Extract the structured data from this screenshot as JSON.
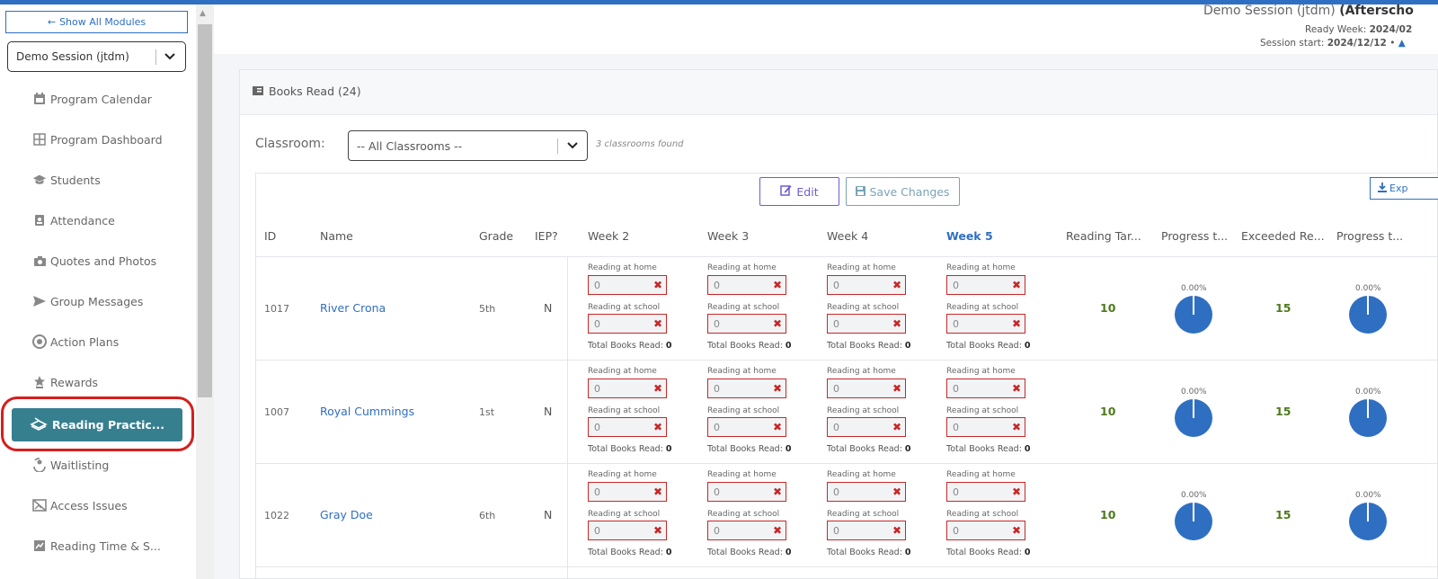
{
  "sidebar": {
    "show_all": "Show All Modules",
    "session": "Demo Session (jtdm)",
    "items": [
      {
        "label": "Program Calendar",
        "icon": "calendar-icon"
      },
      {
        "label": "Program Dashboard",
        "icon": "grid-icon"
      },
      {
        "label": "Students",
        "icon": "graduation-cap-icon"
      },
      {
        "label": "Attendance",
        "icon": "id-badge-icon"
      },
      {
        "label": "Quotes and Photos",
        "icon": "camera-icon"
      },
      {
        "label": "Group Messages",
        "icon": "send-icon"
      },
      {
        "label": "Action Plans",
        "icon": "target-icon"
      },
      {
        "label": "Rewards",
        "icon": "award-icon"
      },
      {
        "label": "Reading Practic...",
        "icon": "book-icon",
        "active": true
      },
      {
        "label": "Waitlisting",
        "icon": "user-refresh-icon"
      },
      {
        "label": "Access Issues",
        "icon": "no-image-icon"
      },
      {
        "label": "Reading Time & S...",
        "icon": "chart-icon"
      }
    ]
  },
  "header": {
    "session_name": "Demo Session (jtdm)",
    "session_type": "(Afterscho",
    "ready_week_label": "Ready Week:",
    "ready_week_value": "2024/02",
    "session_start_label": "Session start:",
    "session_start_value": "2024/12/12",
    "session_start_sep": "•"
  },
  "card": {
    "title": "Books Read (24)",
    "classroom_label": "Classroom:",
    "classroom_value": "-- All Classrooms --",
    "classrooms_found": "3 classrooms found",
    "edit_label": "Edit",
    "save_label": "Save Changes",
    "export_label": "Exp"
  },
  "table": {
    "columns": [
      "ID",
      "Name",
      "Grade",
      "IEP?",
      "Week 2",
      "Week 3",
      "Week 4",
      "Week 5",
      "Reading Tar...",
      "Progress t...",
      "Exceeded Re...",
      "Progress t..."
    ],
    "home_label": "Reading at home",
    "school_label": "Reading at school",
    "total_label": "Total Books Read:",
    "rows": [
      {
        "id": "1017",
        "name": "River Crona",
        "grade": "5th",
        "iep": "N",
        "home": "0",
        "school": "0",
        "total": "0",
        "target": "10",
        "progress1": "0.00%",
        "exceeded": "15",
        "progress2": "0.00%"
      },
      {
        "id": "1007",
        "name": "Royal Cummings",
        "grade": "1st",
        "iep": "N",
        "home": "0",
        "school": "0",
        "total": "0",
        "target": "10",
        "progress1": "0.00%",
        "exceeded": "15",
        "progress2": "0.00%"
      },
      {
        "id": "1022",
        "name": "Gray Doe",
        "grade": "6th",
        "iep": "N",
        "home": "0",
        "school": "0",
        "total": "0",
        "target": "10",
        "progress1": "0.00%",
        "exceeded": "15",
        "progress2": "0.00%"
      }
    ]
  }
}
